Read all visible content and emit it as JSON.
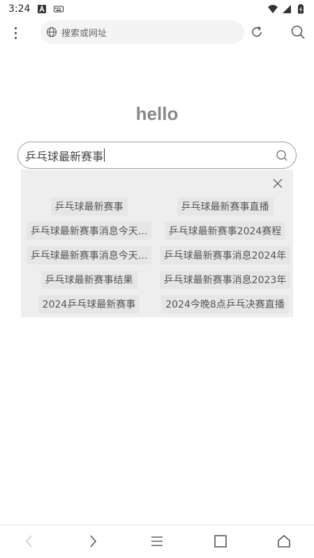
{
  "status_bar": {
    "time": "3:24",
    "icons": [
      "notification-a-icon",
      "keyboard-icon",
      "wifi-icon",
      "signal-icon",
      "battery-charging-icon"
    ]
  },
  "toolbar": {
    "url_placeholder": "搜索或网址",
    "icons": [
      "more-vertical-icon",
      "globe-icon",
      "reload-icon",
      "search-icon"
    ]
  },
  "main": {
    "title": "hello",
    "search_value": "乒乓球最新赛事"
  },
  "suggestions": {
    "items": [
      "乒乓球最新赛事",
      "乒乓球最新赛事直播",
      "乒乓球最新赛事消息今天...",
      "乒乓球最新赛事2024赛程",
      "乒乓球最新赛事消息今天...",
      "乒乓球最新赛事消息2024年",
      "乒乓球最新赛事结果",
      "乒乓球最新赛事消息2023年",
      "2024乒乓球最新赛事",
      "2024今晚8点乒乓决赛直播"
    ]
  },
  "bottom_nav": {
    "icons": [
      "back-icon",
      "forward-icon",
      "menu-icon",
      "tabs-icon",
      "home-icon"
    ]
  },
  "colors": {
    "title": "#888888",
    "panel_bg": "#eeeeee",
    "border": "#9a9a9a"
  }
}
